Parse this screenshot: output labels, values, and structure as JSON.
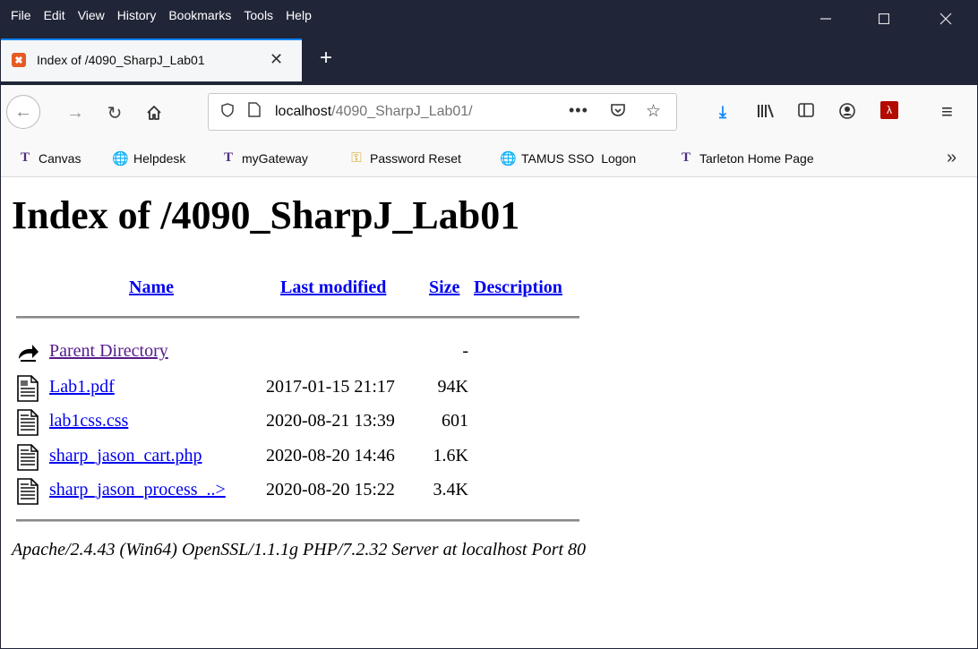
{
  "browser": {
    "menu": [
      "File",
      "Edit",
      "View",
      "History",
      "Bookmarks",
      "Tools",
      "Help"
    ],
    "tab": {
      "title": "Index of /4090_SharpJ_Lab01"
    },
    "url": {
      "host": "localhost",
      "path": "/4090_SharpJ_Lab01/"
    },
    "accent_color": "#0a84ff",
    "bookmarks": [
      {
        "label": "Canvas",
        "icon": "tarleton-icon"
      },
      {
        "label": "Helpdesk",
        "icon": "globe-icon"
      },
      {
        "label": "myGateway",
        "icon": "tarleton-icon"
      },
      {
        "label": "Password Reset",
        "icon": "key-icon"
      },
      {
        "label": "TAMUS SSO  Logon",
        "icon": "globe-icon"
      },
      {
        "label": "Tarleton Home Page",
        "icon": "tarleton-icon"
      }
    ]
  },
  "page": {
    "title": "Index of /4090_SharpJ_Lab01",
    "columns": {
      "name": "Name",
      "last_modified": "Last modified",
      "size": "Size",
      "description": "Description"
    },
    "rows": [
      {
        "name": "Parent Directory",
        "date": "",
        "size": "-",
        "icon": "back-arrow-icon"
      },
      {
        "name": "Lab1.pdf",
        "date": "2017-01-15 21:17",
        "size": "94K",
        "icon": "layout-file-icon"
      },
      {
        "name": "lab1css.css",
        "date": "2020-08-21 13:39",
        "size": "601",
        "icon": "text-file-icon"
      },
      {
        "name": "sharp_jason_cart.php",
        "date": "2020-08-20 14:46",
        "size": "1.6K",
        "icon": "text-file-icon"
      },
      {
        "name": "sharp_jason_process_..>",
        "date": "2020-08-20 15:22",
        "size": "3.4K",
        "icon": "text-file-icon"
      }
    ],
    "address": "Apache/2.4.43 (Win64) OpenSSL/1.1.1g PHP/7.2.32 Server at localhost Port 80"
  }
}
